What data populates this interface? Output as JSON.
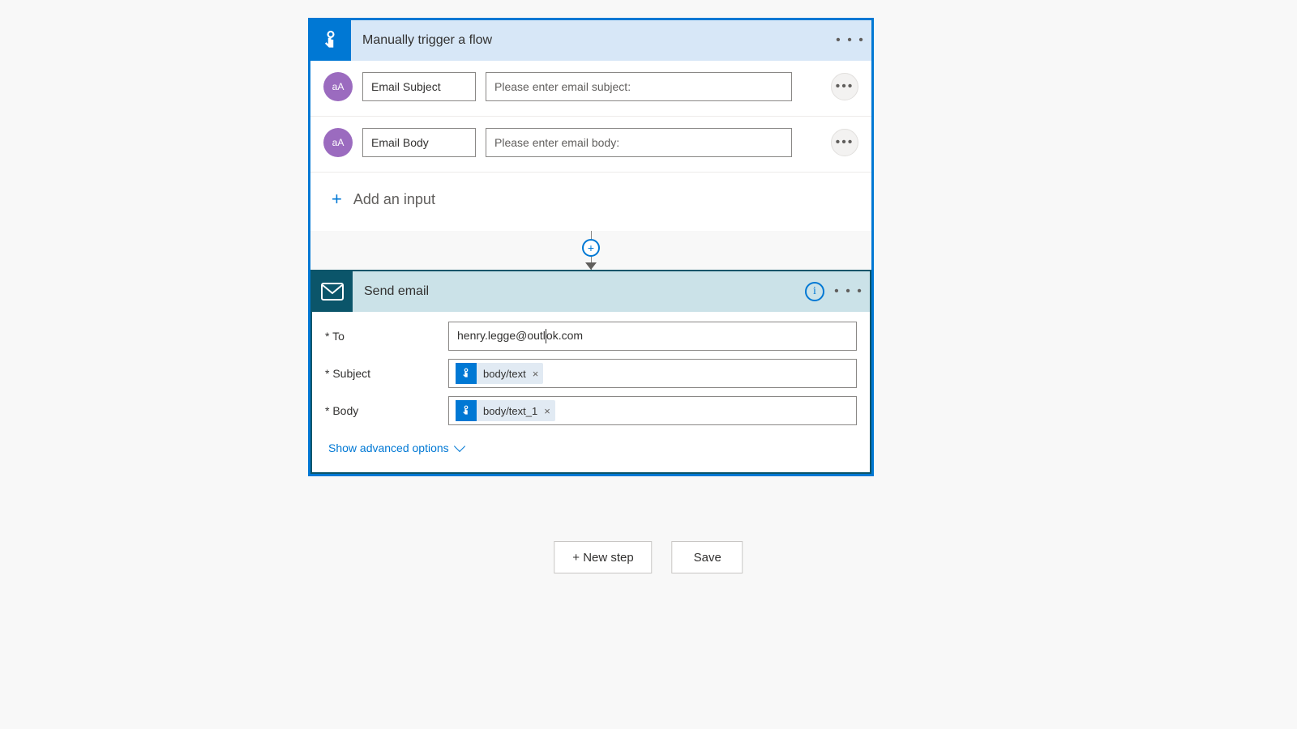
{
  "trigger": {
    "title": "Manually trigger a flow",
    "inputs": [
      {
        "badge": "aA",
        "name": "Email Subject",
        "prompt": "Please enter email subject:"
      },
      {
        "badge": "aA",
        "name": "Email Body",
        "prompt": "Please enter email body:"
      }
    ],
    "add_input_label": "Add an input"
  },
  "action": {
    "title": "Send email",
    "fields": {
      "to": {
        "label": "* To",
        "value": "henry.legge@outlook.com"
      },
      "subject": {
        "label": "* Subject",
        "token": "body/text"
      },
      "body": {
        "label": "* Body",
        "token": "body/text_1"
      }
    },
    "advanced_label": "Show advanced options"
  },
  "buttons": {
    "new_step": "+ New step",
    "save": "Save"
  }
}
